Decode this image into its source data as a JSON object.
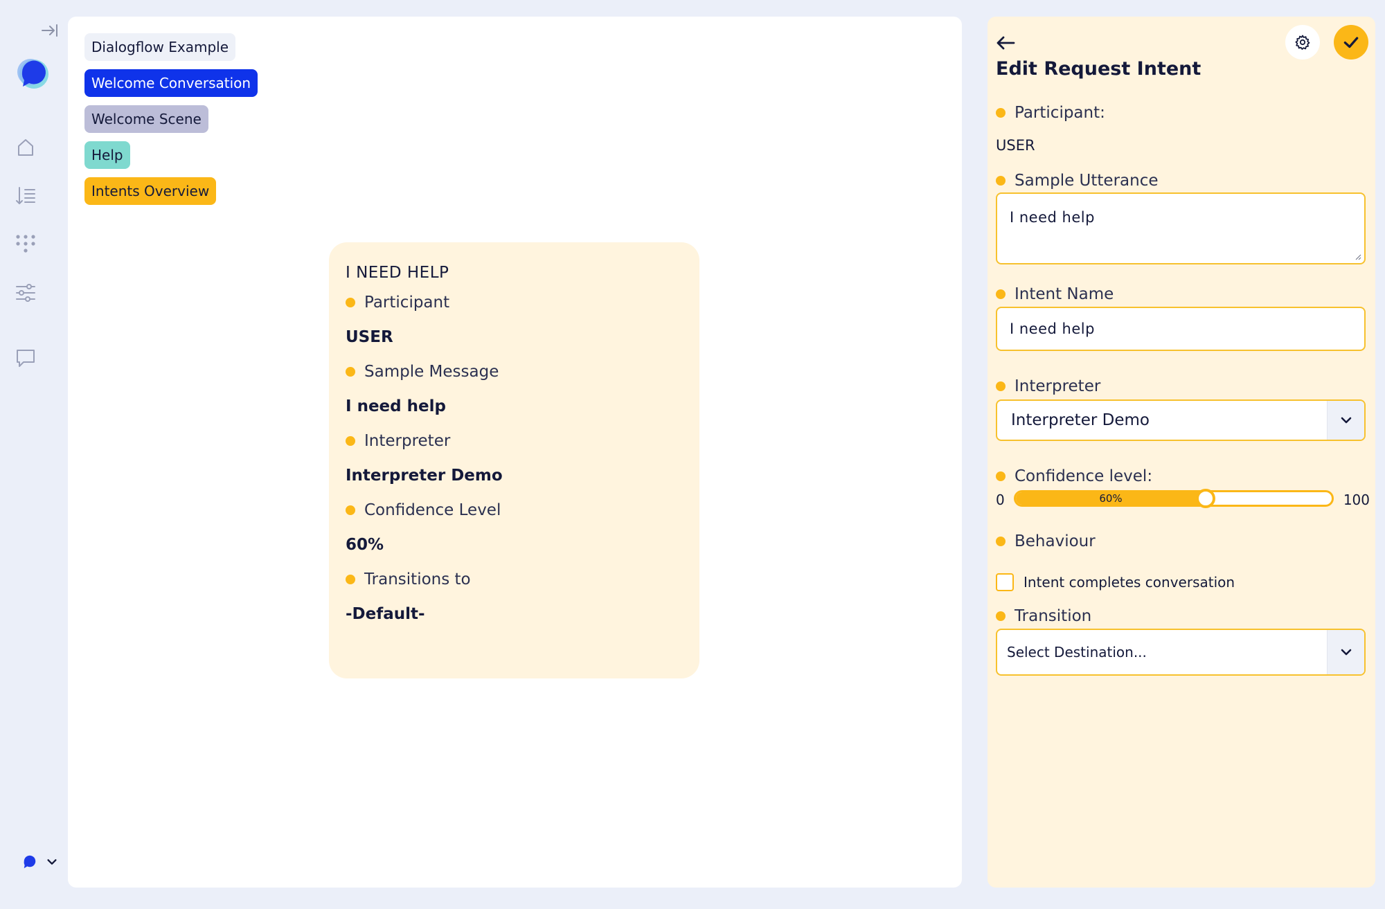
{
  "breadcrumbs": [
    "Dialogflow Example",
    "Welcome Conversation",
    "Welcome Scene",
    "Help",
    "Intents Overview"
  ],
  "node": {
    "title": "I NEED HELP",
    "participant_label": "Participant",
    "participant_value": "USER",
    "sample_label": "Sample Message",
    "sample_value": "I need help",
    "interpreter_label": "Interpreter",
    "interpreter_value": "Interpreter Demo",
    "confidence_label": "Confidence Level",
    "confidence_value": "60%",
    "transitions_label": "Transitions to",
    "transitions_value": "-Default-"
  },
  "panel": {
    "title": "Edit Request Intent",
    "participant_label": "Participant:",
    "participant_value": "USER",
    "utterance_label": "Sample Utterance",
    "utterance_value": "I need help",
    "intent_name_label": "Intent Name",
    "intent_name_value": "I need help",
    "interpreter_label": "Interpreter",
    "interpreter_value": "Interpreter Demo",
    "confidence_label": "Confidence level:",
    "confidence_min": "0",
    "confidence_max": "100",
    "confidence_percent": 60,
    "confidence_text": "60%",
    "behaviour_label": "Behaviour",
    "behaviour_checkbox_label": "Intent completes conversation",
    "behaviour_checked": false,
    "transition_label": "Transition",
    "transition_placeholder": "Select Destination..."
  },
  "colors": {
    "accent": "#fbb717",
    "brand_blue": "#0f33ea",
    "panel_bg": "#fff4de",
    "page_bg": "#ebeff9"
  },
  "icons": [
    "collapse-sidebar-icon",
    "app-logo",
    "home-icon",
    "list-order-icon",
    "grid-dots-icon",
    "sliders-icon",
    "chat-icon",
    "account-icon",
    "chevron-down-icon",
    "back-arrow-icon",
    "gear-icon",
    "checkmark-icon"
  ]
}
